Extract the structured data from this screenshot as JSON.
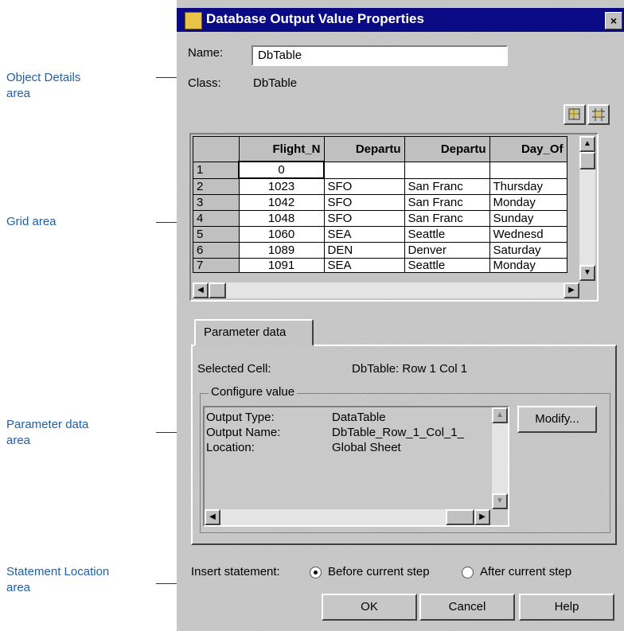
{
  "callouts": {
    "object_details": [
      "Object Details",
      "area"
    ],
    "grid": [
      "Grid area"
    ],
    "parameter_data": [
      "Parameter data",
      "area"
    ],
    "statement_location": [
      "Statement Location",
      "area"
    ]
  },
  "dialog": {
    "title": "Database Output Value Properties",
    "close_glyph": "×",
    "name_label": "Name:",
    "name_value": "DbTable",
    "class_label": "Class:",
    "class_value": "DbTable",
    "toolbar_icons": [
      "grid-select-icon",
      "grid-crosshair-icon"
    ]
  },
  "grid": {
    "headers": [
      "Flight_N",
      "Departu",
      "Departu",
      "Day_Of"
    ],
    "rows": [
      {
        "row": "1",
        "cells": [
          "0",
          "",
          "",
          ""
        ]
      },
      {
        "row": "2",
        "cells": [
          "1023",
          "SFO",
          "San Franc",
          "Thursday"
        ]
      },
      {
        "row": "3",
        "cells": [
          "1042",
          "SFO",
          "San Franc",
          "Monday"
        ]
      },
      {
        "row": "4",
        "cells": [
          "1048",
          "SFO",
          "San Franc",
          "Sunday"
        ]
      },
      {
        "row": "5",
        "cells": [
          "1060",
          "SEA",
          "Seattle",
          "Wednesd"
        ]
      },
      {
        "row": "6",
        "cells": [
          "1089",
          "DEN",
          "Denver",
          "Saturday"
        ]
      },
      {
        "row": "7",
        "cells": [
          "1091",
          "SEA",
          "Seattle",
          "Monday"
        ]
      }
    ]
  },
  "param": {
    "tab_label": "Parameter data",
    "selected_cell_label": "Selected Cell:",
    "selected_cell_value": "DbTable: Row 1 Col 1",
    "group_title": "Configure value",
    "output_type_label": "Output Type:",
    "output_type_value": "DataTable",
    "output_name_label": "Output Name:",
    "output_name_value": "DbTable_Row_1_Col_1_",
    "location_label": "Location:",
    "location_value": "Global Sheet",
    "modify_label": "Modify..."
  },
  "statement": {
    "label": "Insert statement:",
    "before_label": "Before current step",
    "after_label": "After current step",
    "selected": "before"
  },
  "buttons": {
    "ok": "OK",
    "cancel": "Cancel",
    "help": "Help"
  }
}
